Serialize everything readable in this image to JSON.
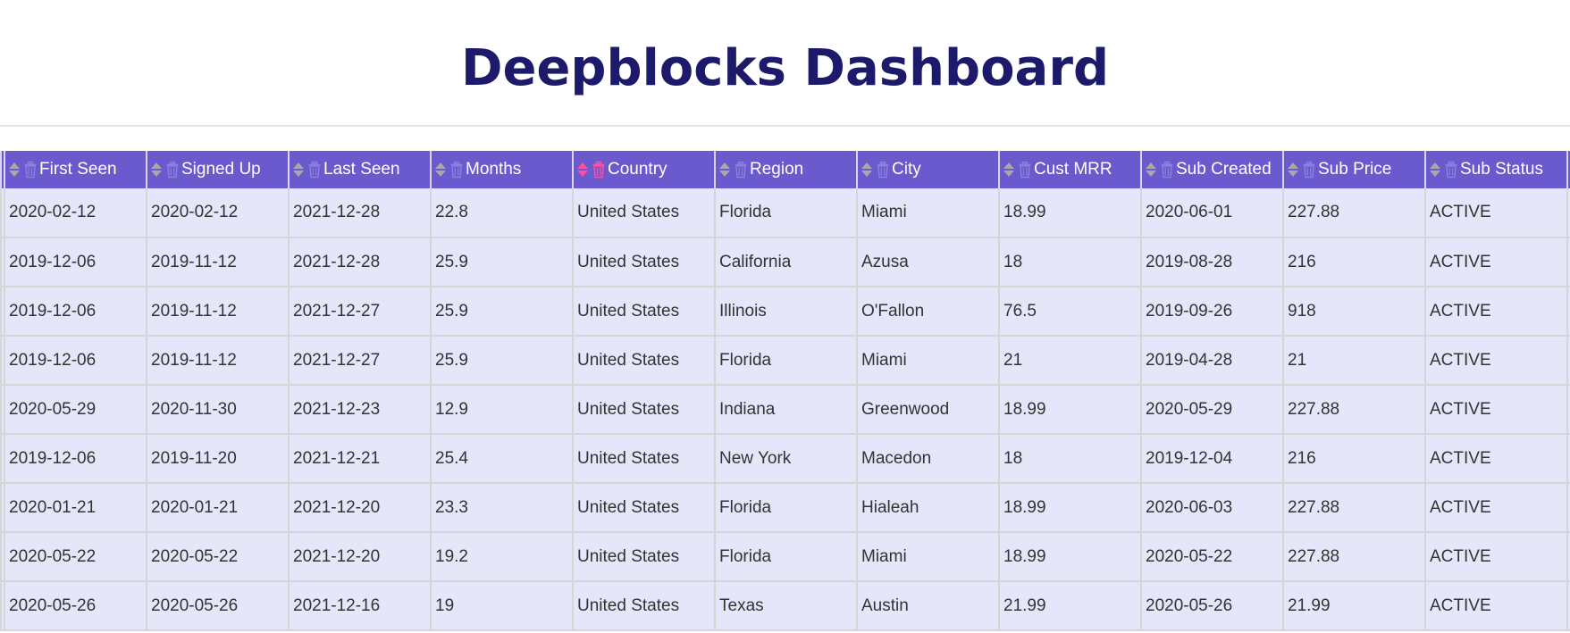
{
  "page": {
    "title": "Deepblocks Dashboard"
  },
  "colors": {
    "title": "#1d1a6b",
    "header_bg": "#6a5acd",
    "row_bg": "#e6e6fa",
    "icon_inactive": "#8c7fe0",
    "icon_active": "#ff4fa3"
  },
  "table": {
    "columns": [
      {
        "label": "First Seen",
        "sort_active": false
      },
      {
        "label": "Signed Up",
        "sort_active": false
      },
      {
        "label": "Last Seen",
        "sort_active": false
      },
      {
        "label": "Months",
        "sort_active": false
      },
      {
        "label": "Country",
        "sort_active": true
      },
      {
        "label": "Region",
        "sort_active": false
      },
      {
        "label": "City",
        "sort_active": false
      },
      {
        "label": "Cust MRR",
        "sort_active": false
      },
      {
        "label": "Sub Created",
        "sort_active": false
      },
      {
        "label": "Sub Price",
        "sort_active": false
      },
      {
        "label": "Sub Status",
        "sort_active": false
      }
    ],
    "rows": [
      [
        "2020-02-12",
        "2020-02-12",
        "2021-12-28",
        "22.8",
        "United States",
        "Florida",
        "Miami",
        "18.99",
        "2020-06-01",
        "227.88",
        "ACTIVE"
      ],
      [
        "2019-12-06",
        "2019-11-12",
        "2021-12-28",
        "25.9",
        "United States",
        "California",
        "Azusa",
        "18",
        "2019-08-28",
        "216",
        "ACTIVE"
      ],
      [
        "2019-12-06",
        "2019-11-12",
        "2021-12-27",
        "25.9",
        "United States",
        "Illinois",
        "O'Fallon",
        "76.5",
        "2019-09-26",
        "918",
        "ACTIVE"
      ],
      [
        "2019-12-06",
        "2019-11-12",
        "2021-12-27",
        "25.9",
        "United States",
        "Florida",
        "Miami",
        "21",
        "2019-04-28",
        "21",
        "ACTIVE"
      ],
      [
        "2020-05-29",
        "2020-11-30",
        "2021-12-23",
        "12.9",
        "United States",
        "Indiana",
        "Greenwood",
        "18.99",
        "2020-05-29",
        "227.88",
        "ACTIVE"
      ],
      [
        "2019-12-06",
        "2019-11-20",
        "2021-12-21",
        "25.4",
        "United States",
        "New York",
        "Macedon",
        "18",
        "2019-12-04",
        "216",
        "ACTIVE"
      ],
      [
        "2020-01-21",
        "2020-01-21",
        "2021-12-20",
        "23.3",
        "United States",
        "Florida",
        "Hialeah",
        "18.99",
        "2020-06-03",
        "227.88",
        "ACTIVE"
      ],
      [
        "2020-05-22",
        "2020-05-22",
        "2021-12-20",
        "19.2",
        "United States",
        "Florida",
        "Miami",
        "18.99",
        "2020-05-22",
        "227.88",
        "ACTIVE"
      ],
      [
        "2020-05-26",
        "2020-05-26",
        "2021-12-16",
        "19",
        "United States",
        "Texas",
        "Austin",
        "21.99",
        "2020-05-26",
        "21.99",
        "ACTIVE"
      ]
    ]
  }
}
